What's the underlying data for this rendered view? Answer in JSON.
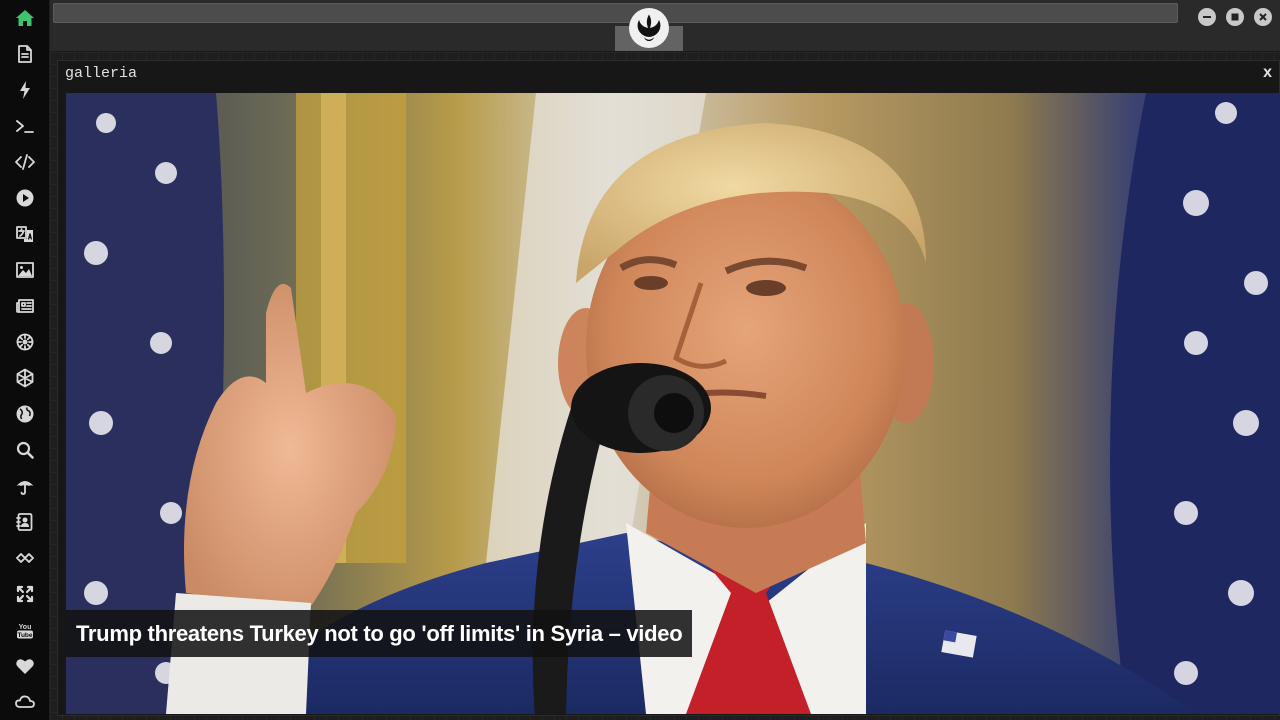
{
  "app": {
    "logo_icon": "rebel-alliance-icon",
    "accent_color": "#3ec46d"
  },
  "sidebar": {
    "items": [
      {
        "name": "home",
        "icon": "home-icon",
        "active": true
      },
      {
        "name": "document",
        "icon": "document-icon"
      },
      {
        "name": "lightning",
        "icon": "lightning-icon"
      },
      {
        "name": "terminal",
        "icon": "terminal-icon"
      },
      {
        "name": "code",
        "icon": "code-icon"
      },
      {
        "name": "play",
        "icon": "play-icon"
      },
      {
        "name": "translate",
        "icon": "translate-icon"
      },
      {
        "name": "image",
        "icon": "image-icon"
      },
      {
        "name": "news",
        "icon": "newspaper-icon"
      },
      {
        "name": "settings",
        "icon": "gear-icon"
      },
      {
        "name": "hexagon",
        "icon": "hexagon-icon"
      },
      {
        "name": "globe",
        "icon": "globe-icon"
      },
      {
        "name": "search",
        "icon": "search-icon"
      },
      {
        "name": "umbrella",
        "icon": "umbrella-icon"
      },
      {
        "name": "contacts",
        "icon": "address-book-icon"
      },
      {
        "name": "links",
        "icon": "link-icon"
      },
      {
        "name": "fullscreen",
        "icon": "expand-icon"
      },
      {
        "name": "youtube",
        "icon": "youtube-icon"
      },
      {
        "name": "favorites",
        "icon": "heart-icon"
      },
      {
        "name": "cloud",
        "icon": "cloud-icon"
      }
    ]
  },
  "window_controls": {
    "minimize_icon": "minimize-icon",
    "maximize_icon": "maximize-icon",
    "close_icon": "close-icon"
  },
  "panel": {
    "title": "galleria",
    "close_label": "x"
  },
  "gallery": {
    "caption": "Trump threatens Turkey not to go 'off limits' in Syria – video"
  }
}
